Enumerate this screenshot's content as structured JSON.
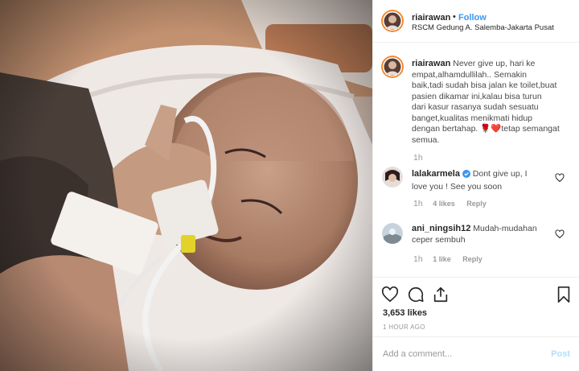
{
  "post": {
    "username": "riairawan",
    "follow_label": "Follow",
    "dot": "•",
    "location": "RSCM Gedung A. Salemba-Jakarta Pusat"
  },
  "caption": {
    "username": "riairawan",
    "lines": [
      "Never give up, hari ke",
      "empat,alhamdullilah.. Semakin",
      "baik,tadi sudah bisa jalan ke toilet,buat",
      "pasien dikamar ini,kalau bisa turun",
      "dari kasur rasanya sudah sesuatu",
      "banget,kualitas menikmati hidup",
      "dengan bertahap. 🌹❤️tetap semangat",
      "semua."
    ],
    "time": "1h"
  },
  "comments": [
    {
      "username": "lalakarmela",
      "verified": true,
      "text_line1": "Dont give up, I",
      "text_line2": "love you ! See you soon",
      "time": "1h",
      "likes": "4 likes",
      "reply": "Reply"
    },
    {
      "username": "ani_ningsih12",
      "verified": false,
      "text_line1": "Mudah-mudahan",
      "text_line2": "ceper sembuh",
      "time": "1h",
      "likes": "1 like",
      "reply": "Reply"
    }
  ],
  "stats": {
    "likes": "3,653 likes",
    "time_ago": "1 HOUR AGO"
  },
  "add_comment": {
    "placeholder": "Add a comment...",
    "post_label": "Post"
  },
  "icons": [
    "heart-icon",
    "comment-icon",
    "share-icon",
    "bookmark-icon",
    "verified-icon"
  ],
  "colors": {
    "follow": "#3897f0",
    "post_disabled": "#b2dffc",
    "muted": "#999999",
    "border": "#efefef"
  }
}
